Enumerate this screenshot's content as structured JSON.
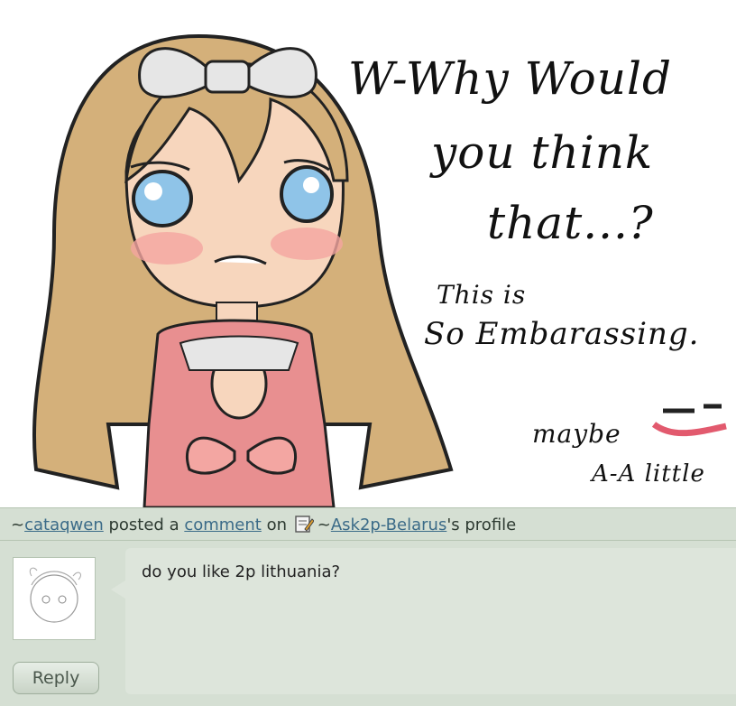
{
  "artwork": {
    "caption_line1": "W-Why Would",
    "caption_line2": "you think",
    "caption_line3": "that...?",
    "caption_small1": "This is",
    "caption_small2": "So Embarassing.",
    "caption_maybe": "maybe",
    "caption_little": "A-A little"
  },
  "comment": {
    "author_prefix": "~",
    "author": "cataqwen",
    "action": " posted a ",
    "link_label": "comment",
    "on_label": " on ",
    "profile_prefix": "~",
    "profile_name": "Ask2p-Belarus",
    "profile_suffix": "'s profile",
    "profile_icon": "edit-profile-icon",
    "text": "do you like 2p lithuania?",
    "reply_label": "Reply"
  },
  "colors": {
    "panel_bg": "#d5dfd3",
    "bubble_bg": "#dde5db",
    "link": "#3b6b88",
    "hair": "#d4b07a",
    "dress": "#e88f90",
    "bow": "#e6e6e6",
    "eyes": "#8fc4e8"
  }
}
